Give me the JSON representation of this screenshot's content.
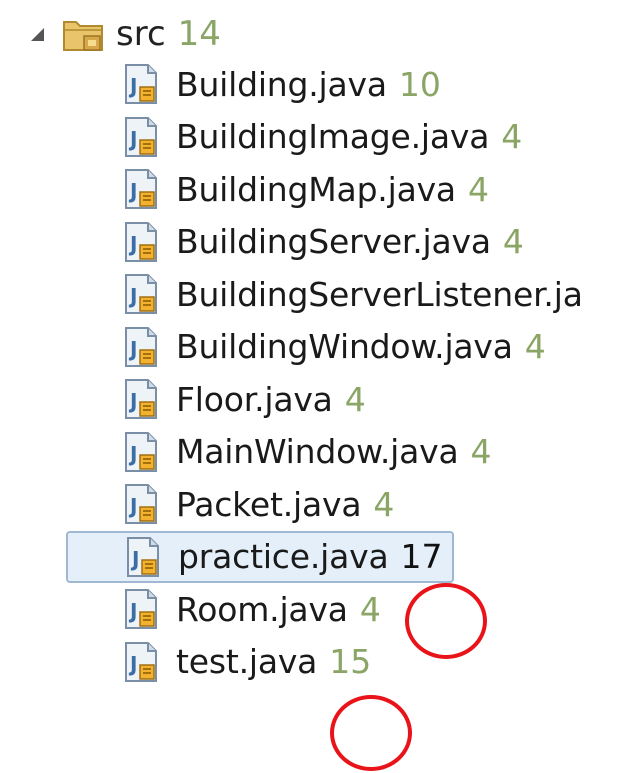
{
  "tree": {
    "root": {
      "label": "src",
      "count": "14",
      "icon": "package-folder-icon"
    },
    "files": [
      {
        "name": "Building.java",
        "count": "10",
        "icon": "java-file-icon",
        "selected": false
      },
      {
        "name": "BuildingImage.java",
        "count": "4",
        "icon": "java-file-icon",
        "selected": false
      },
      {
        "name": "BuildingMap.java",
        "count": "4",
        "icon": "java-file-icon",
        "selected": false
      },
      {
        "name": "BuildingServer.java",
        "count": "4",
        "icon": "java-file-icon",
        "selected": false
      },
      {
        "name": "BuildingServerListener.ja",
        "count": "",
        "icon": "java-file-icon",
        "selected": false
      },
      {
        "name": "BuildingWindow.java",
        "count": "4",
        "icon": "java-file-icon",
        "selected": false
      },
      {
        "name": "Floor.java",
        "count": "4",
        "icon": "java-file-icon",
        "selected": false
      },
      {
        "name": "MainWindow.java",
        "count": "4",
        "icon": "java-file-icon",
        "selected": false
      },
      {
        "name": "Packet.java",
        "count": "4",
        "icon": "java-file-icon",
        "selected": false
      },
      {
        "name": "practice.java",
        "count": "17",
        "icon": "java-file-icon",
        "selected": true
      },
      {
        "name": "Room.java",
        "count": "4",
        "icon": "java-file-icon",
        "selected": false
      },
      {
        "name": "test.java",
        "count": "15",
        "icon": "java-file-icon",
        "selected": false
      }
    ]
  },
  "annotations": {
    "color": "#e8141a",
    "targets": [
      "practice.java count",
      "test.java count"
    ]
  },
  "colors": {
    "count_text": "#8aa565",
    "selection_bg": "#e5eff9",
    "selection_border": "#9fb8d3"
  }
}
